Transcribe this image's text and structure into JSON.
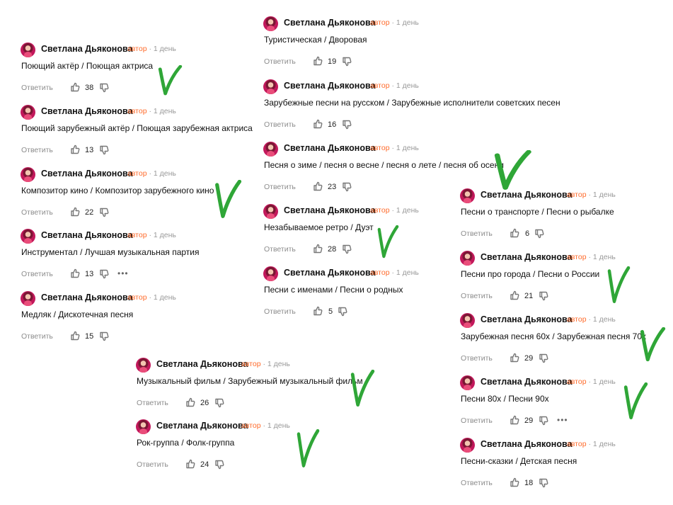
{
  "author_name": "Светлана Дьяконова",
  "author_badge": "автор",
  "time": "1 день",
  "reply_label": "Ответить",
  "comments": [
    {
      "text": "Поющий актёр / Поющая актриса",
      "likes": "38"
    },
    {
      "text": "Поющий зарубежный актёр / Поющая зарубежная актриса",
      "likes": "13"
    },
    {
      "text": "Композитор кино / Композитор зарубежного кино",
      "likes": "22"
    },
    {
      "text": "Инструментал / Лучшая музыкальная партия",
      "likes": "13"
    },
    {
      "text": "Медляк / Дискотечная песня",
      "likes": "15"
    },
    {
      "text": "Туристическая / Дворовая",
      "likes": "19"
    },
    {
      "text": "Зарубежные песни на русском / Зарубежные исполнители советских песен",
      "likes": "16"
    },
    {
      "text": "Песня о зиме / песня о весне / песня о лете / песня об осени",
      "likes": "23"
    },
    {
      "text": "Незабываемое ретро / Дуэт",
      "likes": "28"
    },
    {
      "text": "Песни с именами / Песни о родных",
      "likes": "5"
    },
    {
      "text": "Музыкальный фильм / Зарубежный музыкальный фильм",
      "likes": "26"
    },
    {
      "text": "Рок-группа / Фолк-группа",
      "likes": "24"
    },
    {
      "text": "Песни о транспорте / Песни о рыбалке",
      "likes": "6"
    },
    {
      "text": "Песни про города / Песни о России",
      "likes": "21"
    },
    {
      "text": "Зарубежная песня 60х / Зарубежная песня 70х",
      "likes": "29"
    },
    {
      "text": "Песни 80х / Песни 90х",
      "likes": "29"
    },
    {
      "text": "Песни-сказки / Детская песня",
      "likes": "18"
    }
  ],
  "accent_color": "#ff6a2a",
  "check_color": "#2fa637"
}
